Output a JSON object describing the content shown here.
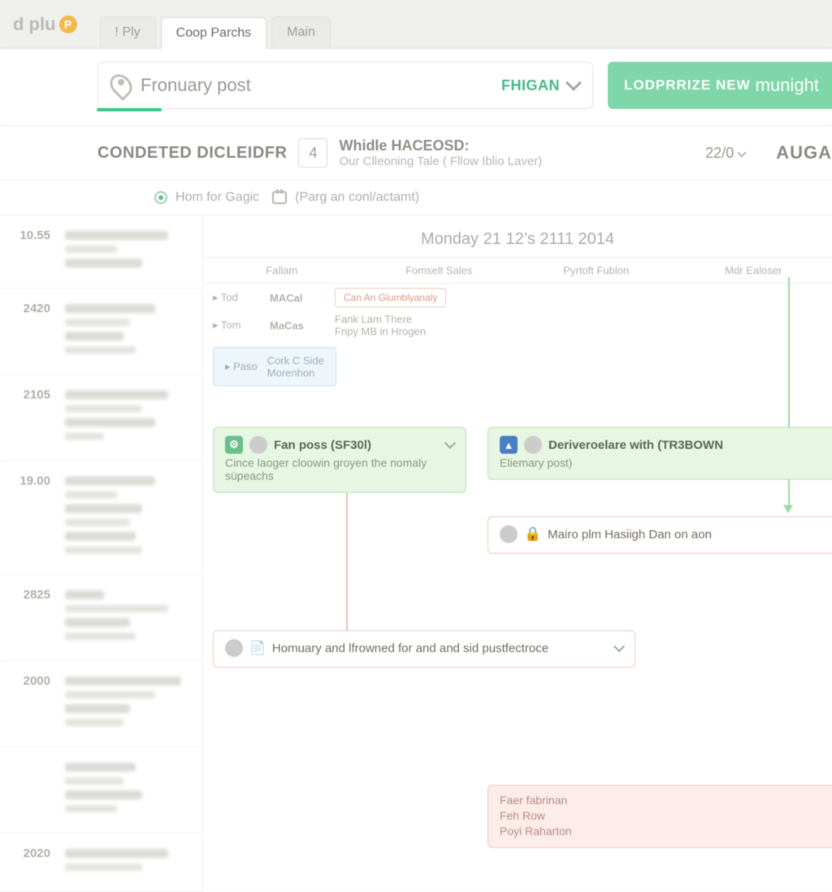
{
  "brand": {
    "name": "d plu",
    "coin_glyph": "P"
  },
  "tabs": [
    {
      "label": "! Ply",
      "active": false
    },
    {
      "label": "Coop Parchs",
      "active": true
    },
    {
      "label": "Main",
      "active": false
    }
  ],
  "location": {
    "label": "Fronuary post",
    "selected": "Fhigan"
  },
  "cta": {
    "strong": "Lodprrize new",
    "light": "munight"
  },
  "header": {
    "title": "CONDETED DICLEIDFR",
    "badge": "4",
    "subtitle_top": "Whidle HACEOSD:",
    "subtitle_bottom": "Our Clleoning Tale ( Fllow Iblio Laver)",
    "pager": "22/0",
    "month": "AUGA"
  },
  "filter": {
    "radio_label": "Hom for Gagic",
    "calendar_label": "(Parg an conl/actamt)"
  },
  "date_header": "Monday 21 12’s 2111 2014",
  "columns": [
    "Fallam",
    "Fomselt Sales",
    "Pyrtoft Fublon",
    "Mdr Ealoser"
  ],
  "mini_rows": [
    {
      "c1": "▸ Tod",
      "c2": "MACal",
      "c3_pill": "Can An Glumblyanaly"
    },
    {
      "c1": "▸ Tom",
      "c2": "MaCas",
      "c3_text": "Fank Lam There\nFnpy MB in Hrogen"
    }
  ],
  "blue_cell": {
    "a": "▸ Paso",
    "b": "Cork C Side\nMorenhon"
  },
  "times": [
    "10.55",
    "2420",
    "2105",
    "19.00",
    "2825",
    "2000",
    "",
    "2020"
  ],
  "cards": {
    "fan": {
      "title": "Fan poss (SF30l)",
      "sub": "Cince laoger cloowin groyen the nomaly süpeachs"
    },
    "deriv": {
      "title": "Deriveroelare with (TR3BOWN",
      "sub": "Eliemary post)"
    },
    "mairo": {
      "title": "Mairo plm Hasiigh Dan on aon"
    },
    "hom": {
      "title": "Homuary and lfrowned for and and sid pustfectroce"
    },
    "pinklines": [
      "Faer fabrinan",
      "Feh Row",
      "Poyi Raharton"
    ]
  }
}
